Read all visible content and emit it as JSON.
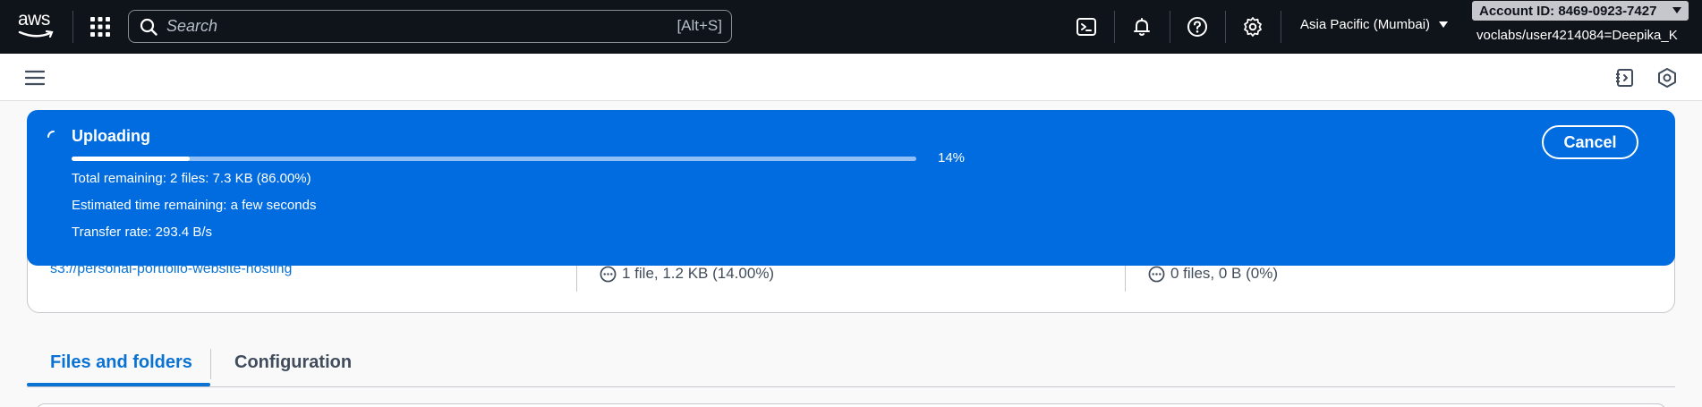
{
  "topnav": {
    "logo_text": "aws",
    "search": {
      "placeholder": "Search",
      "shortcut": "[Alt+S]"
    },
    "region": "Asia Pacific (Mumbai)",
    "account_badge": "Account ID: 8469-0923-7427",
    "user": "voclabs/user4214084=Deepika_K"
  },
  "flash": {
    "title": "Uploading",
    "progress_fraction": 0.14,
    "progress_label": "14%",
    "total_remaining": "Total remaining: 2 files: 7.3 KB (86.00%)",
    "time_remaining": "Estimated time remaining: a few seconds",
    "transfer_rate": "Transfer rate: 293.4 B/s",
    "cancel_label": "Cancel"
  },
  "summary": {
    "destination": "s3://personal-portfolio-website-hosting",
    "succeeded": "1 file, 1.2 KB (14.00%)",
    "failed": "0 files, 0 B (0%)"
  },
  "tabs": [
    {
      "label": "Files and folders",
      "active": true
    },
    {
      "label": "Configuration",
      "active": false
    }
  ],
  "colors": {
    "nav_bg": "#0f141a",
    "flash_blue": "#006ce0",
    "link_blue": "#0972d3"
  }
}
